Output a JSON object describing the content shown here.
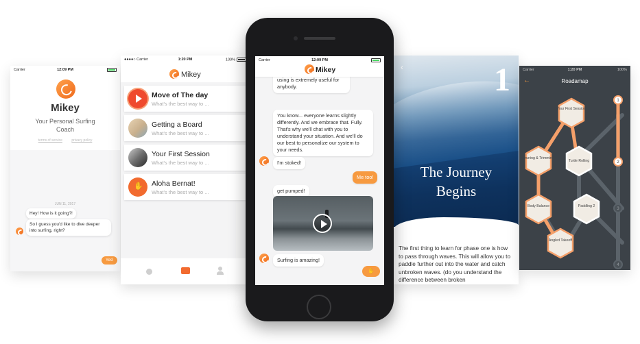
{
  "colors": {
    "accent": "#f79a40",
    "accent_dark": "#ef6a1b",
    "roadmap_bg": "#3c4248"
  },
  "card_intro": {
    "status": {
      "carrier": "Carrier",
      "time": "12:09 PM"
    },
    "app_name": "Mikey",
    "tagline": "Your Personal Surfing Coach",
    "links": [
      "terms of service",
      "privacy policy"
    ],
    "chat": {
      "date": "JUN 11, 2017",
      "messages": [
        "Hey! How is it going?!",
        "So I guess you'd like to dive deeper into surfing, right?"
      ],
      "reply": "Yes!"
    }
  },
  "card_list": {
    "status": {
      "carrier": "●●●●○ Carrier",
      "time": "1:20 PM",
      "battery": "100%"
    },
    "title": "Mikey",
    "items": [
      {
        "title": "Move of The day",
        "subtitle": "What's the best way to ...",
        "icon": "play-icon"
      },
      {
        "title": "Getting a Board",
        "subtitle": "What's the best way to ...",
        "icon": "board-photo"
      },
      {
        "title": "Your First Session",
        "subtitle": "What's the best way to ...",
        "icon": "session-photo"
      },
      {
        "title": "Aloha Bernat!",
        "subtitle": "What's the best way to ...",
        "icon": "shaka-icon"
      }
    ],
    "tabs": [
      "explore-icon",
      "chat-icon",
      "profile-icon"
    ]
  },
  "phone_chat": {
    "status": {
      "carrier": "Carrier",
      "time": "12:09 PM"
    },
    "title": "Mikey",
    "messages": {
      "partial": "using is extremely useful for anybody.",
      "long": "You know... everyone learns slightly differently. And we embrace that. Fully. That's why we'll chat with you to understand your situation. And we'll do our best to personalize our system to your needs.",
      "stoked": "I'm stoked!",
      "user_reply": "Me too!",
      "pumped": "get pumped!",
      "amazing": "Surfing is amazing!"
    }
  },
  "card_journey": {
    "number": "1",
    "heading_line1": "The Journey",
    "heading_line2": "Begins",
    "body": "The first thing to learn for phase one is how to pass through waves. This will allow you to paddle further out into the water and catch unbroken waves. (do you understand the difference between broken"
  },
  "card_roadmap": {
    "status": {
      "carrier": "Carrier",
      "time": "1:20 PM",
      "battery": "100%"
    },
    "title": "Roadamap",
    "nodes": [
      {
        "label": "Your First Session"
      },
      {
        "label": "Truning & Trimming"
      },
      {
        "label": "Turtle Rolling"
      },
      {
        "label": "Body Balance"
      },
      {
        "label": "Paddling 2"
      },
      {
        "label": "Angled Takeoff"
      }
    ],
    "steps": [
      "1",
      "2",
      "3",
      "4"
    ]
  }
}
